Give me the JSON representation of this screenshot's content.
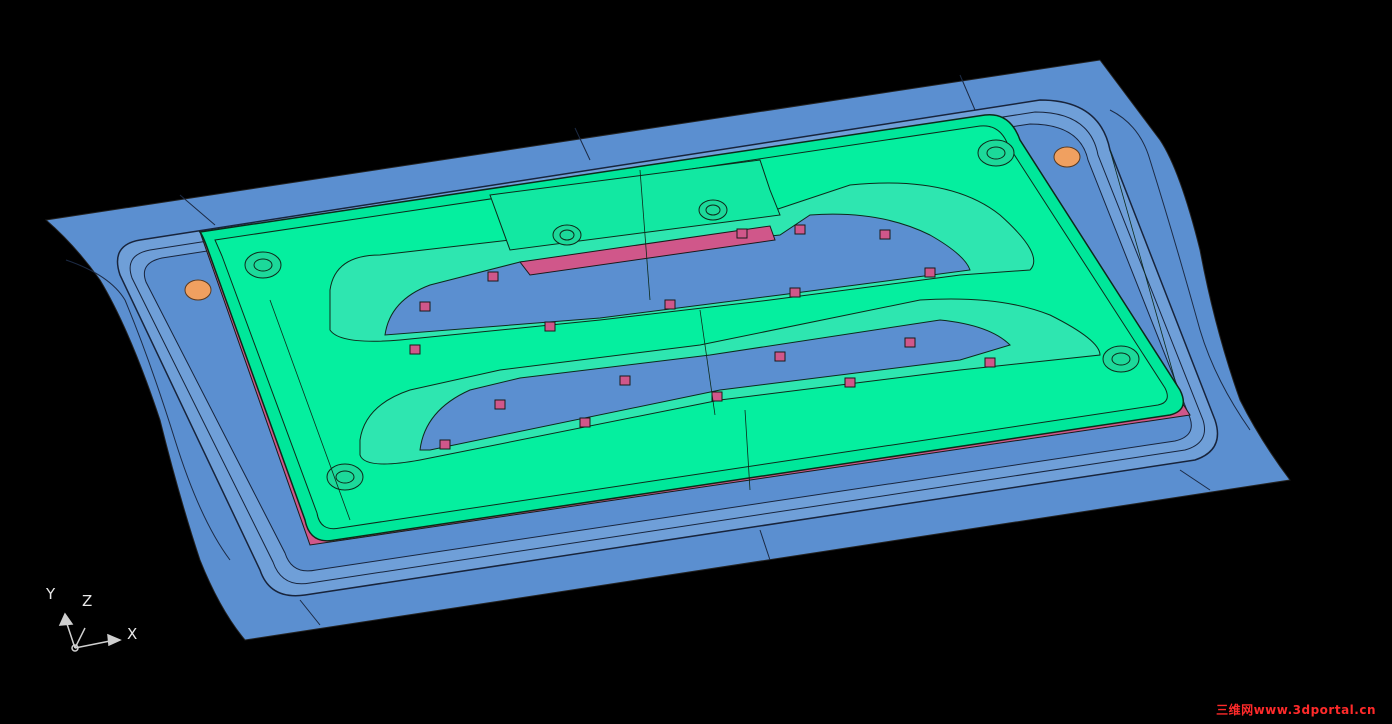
{
  "viewport": {
    "background": "#000000",
    "surface_colors": {
      "binder": "#5b8fd0",
      "punch_face": "#00e79a",
      "flange_trim": "#d0578a",
      "pilot_hole": "#f0a060"
    }
  },
  "axis_triad": {
    "x_label": "X",
    "y_label": "Y",
    "z_label": "Z"
  },
  "watermark": {
    "text": "三维网www.3dportal.cn"
  }
}
